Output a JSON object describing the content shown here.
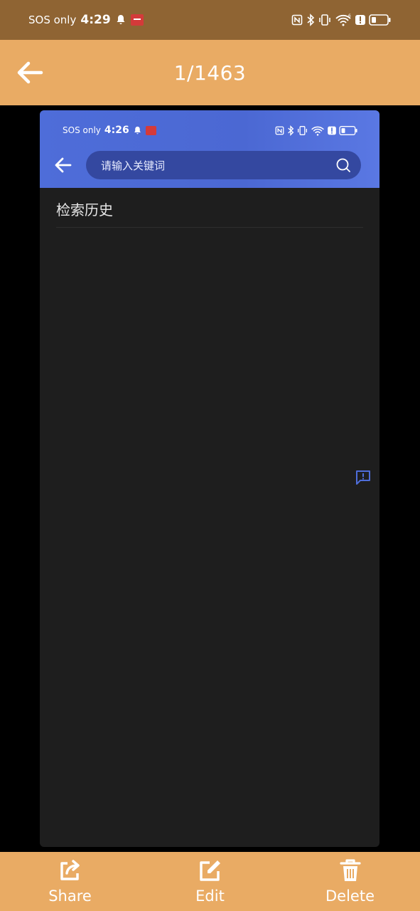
{
  "outer_status": {
    "carrier": "SOS only",
    "time": "4:29"
  },
  "header": {
    "title": "1/1463"
  },
  "preview": {
    "status": {
      "carrier": "SOS only",
      "time": "4:26"
    },
    "search": {
      "placeholder": "请输入关键词"
    },
    "history_title": "检索历史"
  },
  "toolbar": {
    "share_label": "Share",
    "edit_label": "Edit",
    "delete_label": "Delete"
  },
  "colors": {
    "header_bg": "#e9ab64",
    "status_bg": "#8f6433",
    "accent_blue": "#4e6dd9",
    "dark_bg": "#1e1e1e"
  }
}
